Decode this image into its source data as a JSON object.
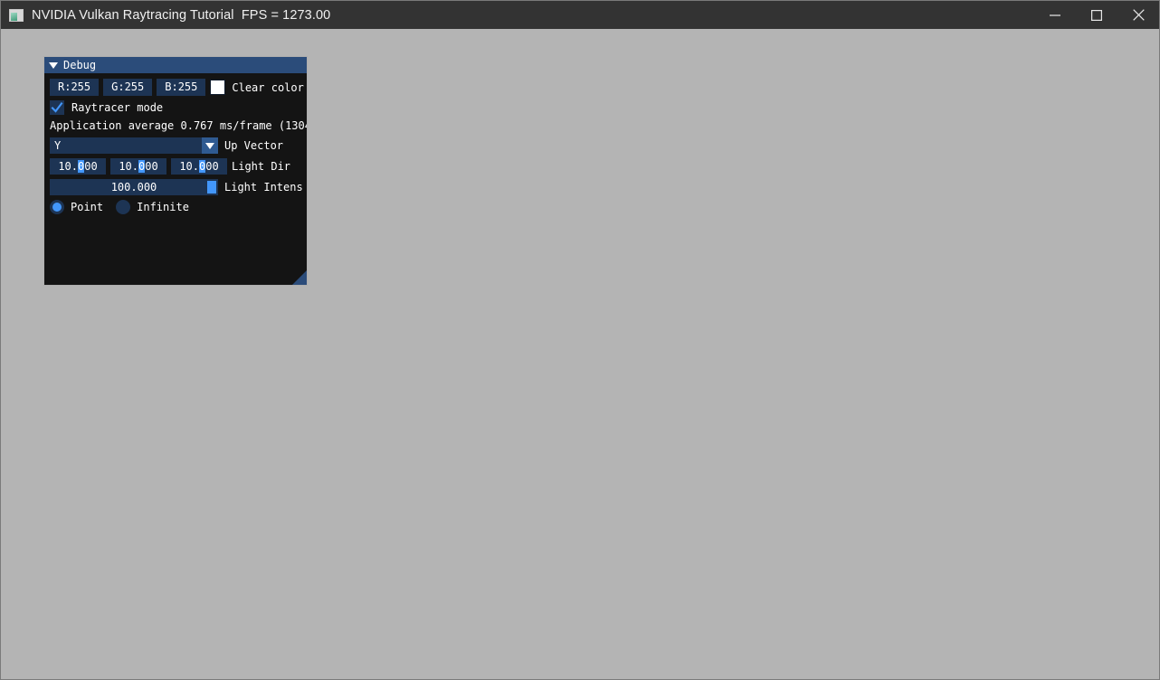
{
  "window": {
    "title": "NVIDIA Vulkan Raytracing Tutorial  FPS = 1273.00",
    "app_icon": "window-app-icon",
    "background_color": "#b4b4b4",
    "titlebar_color": "#333333",
    "controls": {
      "minimize": "minimize-icon",
      "maximize": "maximize-icon",
      "close": "close-icon"
    }
  },
  "debug_panel": {
    "title": "Debug",
    "collapse_icon": "triangle-down-icon",
    "titlebar_color": "#2b4c7a",
    "body_color": "#141414",
    "accent_color": "#4296fa",
    "widget_color": "#1d3454",
    "clear_color": {
      "r_label": "R:255",
      "g_label": "G:255",
      "b_label": "B:255",
      "swatch_color": "#ffffff",
      "label": "Clear color"
    },
    "raytracer_mode": {
      "label": "Raytracer mode",
      "checked": true,
      "check_icon": "check-icon"
    },
    "perf_text": "Application average 0.767 ms/frame (1304",
    "up_vector": {
      "value": "Y",
      "label": "Up Vector",
      "arrow_icon": "chevron-down-icon"
    },
    "light_dir": {
      "label": "Light Dir",
      "x": {
        "prefix": "10.",
        "selected": "0",
        "suffix": "00"
      },
      "y": {
        "prefix": "10.",
        "selected": "0",
        "suffix": "00"
      },
      "z": {
        "prefix": "10.",
        "selected": "0",
        "suffix": "00"
      }
    },
    "light_intensity": {
      "label": "Light Intens",
      "value": "100.000"
    },
    "light_type": {
      "point_label": "Point",
      "infinite_label": "Infinite",
      "selected": "Point"
    },
    "resize_grip": "resize-grip-icon"
  }
}
